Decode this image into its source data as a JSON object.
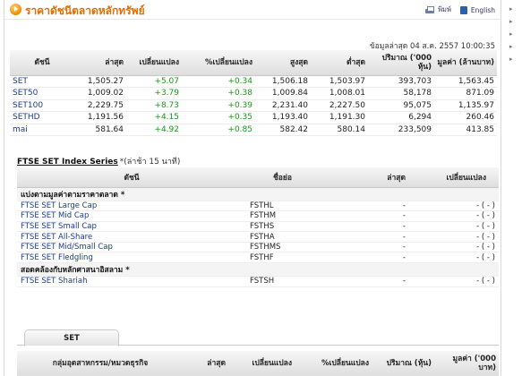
{
  "header": {
    "title": "ราคาดัชนีตลาดหลักทรัพย์",
    "print_label": "พิมพ์",
    "lang_label": "English"
  },
  "timestamp": "ข้อมูลล่าสุด 04 ส.ค. 2557 10:00:35",
  "main_table": {
    "columns": [
      "ดัชนี",
      "ล่าสุด",
      "เปลี่ยนแปลง",
      "%เปลี่ยนแปลง",
      "สูงสุด",
      "ต่ำสุด",
      "ปริมาณ ('000 หุ้น)",
      "มูลค่า (ล้านบาท)"
    ],
    "rows": [
      [
        "SET",
        "1,505.27",
        "+5.07",
        "+0.34",
        "1,506.18",
        "1,503.97",
        "393,703",
        "1,563.45"
      ],
      [
        "SET50",
        "1,009.02",
        "+3.79",
        "+0.38",
        "1,009.84",
        "1,008.01",
        "58,178",
        "871.09"
      ],
      [
        "SET100",
        "2,229.75",
        "+8.73",
        "+0.39",
        "2,231.40",
        "2,227.50",
        "95,075",
        "1,135.97"
      ],
      [
        "SETHD",
        "1,191.56",
        "+4.15",
        "+0.35",
        "1,193.40",
        "1,191.30",
        "6,294",
        "260.46"
      ],
      [
        "mai",
        "581.64",
        "+4.92",
        "+0.85",
        "582.42",
        "580.14",
        "233,509",
        "413.85"
      ]
    ]
  },
  "ftse": {
    "heading": "FTSE SET Index Series",
    "note": "*(ล่าช้า 15 นาที)",
    "columns": [
      "ดัชนี",
      "ชื่อย่อ",
      "ล่าสุด",
      "เปลี่ยนแปลง"
    ],
    "group1": "แบ่งตามมูลค่าตามราคาตลาด *",
    "group2": "สอดคล้องกับหลักศาสนาอิสลาม *",
    "rows1": [
      [
        "FTSE SET Large Cap",
        "FSTHL",
        "-",
        "- ( - )"
      ],
      [
        "FTSE SET Mid Cap",
        "FSTHM",
        "-",
        "- ( - )"
      ],
      [
        "FTSE SET Small Cap",
        "FSTHS",
        "-",
        "- ( - )"
      ],
      [
        "FTSE SET All-Share",
        "FSTHA",
        "-",
        "- ( - )"
      ],
      [
        "FTSE SET Mid/Small Cap",
        "FSTHMS",
        "-",
        "- ( - )"
      ],
      [
        "FTSE SET Fledgling",
        "FSTHF",
        "-",
        "- ( - )"
      ]
    ],
    "rows2": [
      [
        "FTSE SET Shariah",
        "FSTSH",
        "-",
        "- ( - )"
      ]
    ]
  },
  "tabs": {
    "active": "SET"
  },
  "sector_table": {
    "columns": [
      "กลุ่มอุตสาหกรรม/หมวดธุรกิจ",
      "ล่าสุด",
      "เปลี่ยนแปลง",
      "%เปลี่ยนแปลง",
      "ปริมาณ (หุ้น)",
      "มูลค่า ('000 บาท)"
    ]
  }
}
